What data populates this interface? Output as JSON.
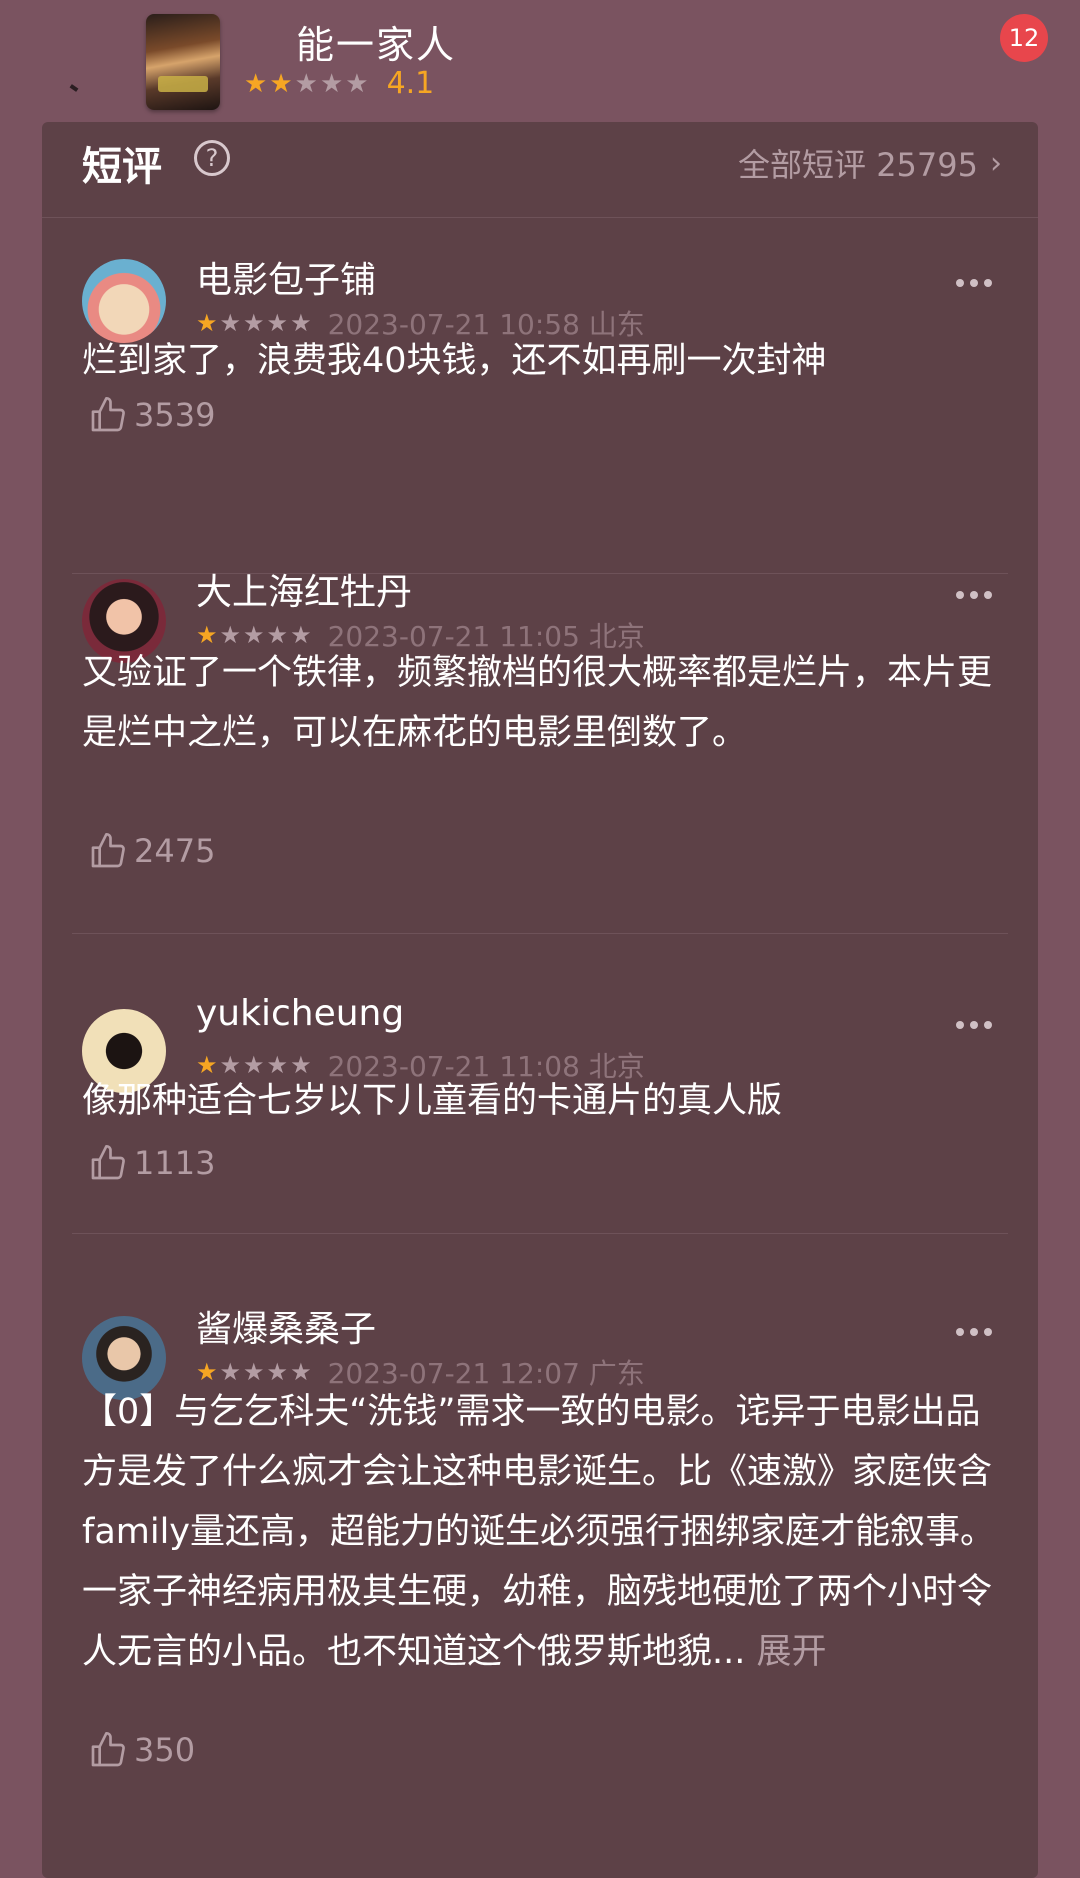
{
  "header": {
    "movie_title": "能一家人",
    "score": "4.1",
    "rating_stars": 2,
    "notification_count": "12"
  },
  "section": {
    "title": "短评",
    "all_reviews_label": "全部短评 25795"
  },
  "comments": [
    {
      "user": "电影包子铺",
      "stars": 1,
      "meta": "2023-07-21 10:58 山东",
      "text": "烂到家了，浪费我40块钱，还不如再刷一次封神",
      "likes": "3539"
    },
    {
      "user": "大上海红牡丹",
      "stars": 1,
      "meta": "2023-07-21 11:05 北京",
      "text": "又验证了一个铁律，频繁撤档的很大概率都是烂片，本片更是烂中之烂，可以在麻花的电影里倒数了。",
      "likes": "2475"
    },
    {
      "user": "yukicheung",
      "stars": 1,
      "meta": "2023-07-21 11:08 北京",
      "text": "像那种适合七岁以下儿童看的卡通片的真人版",
      "likes": "1113"
    },
    {
      "user": "酱爆桑桑子",
      "stars": 1,
      "meta": "2023-07-21 12:07 广东",
      "text": "【0】与乞乞科夫“洗钱”需求一致的电影。诧异于电影出品方是发了什么疯才会让这种电影诞生。比《速激》家庭侠含family量还高，超能力的诞生必须强行捆绑家庭才能叙事。一家子神经病用极其生硬，幼稚，脑残地硬尬了两个小时令人无言的小品。也不知道这个俄罗斯地貌...",
      "expand_label": "展开",
      "likes": "350"
    }
  ]
}
